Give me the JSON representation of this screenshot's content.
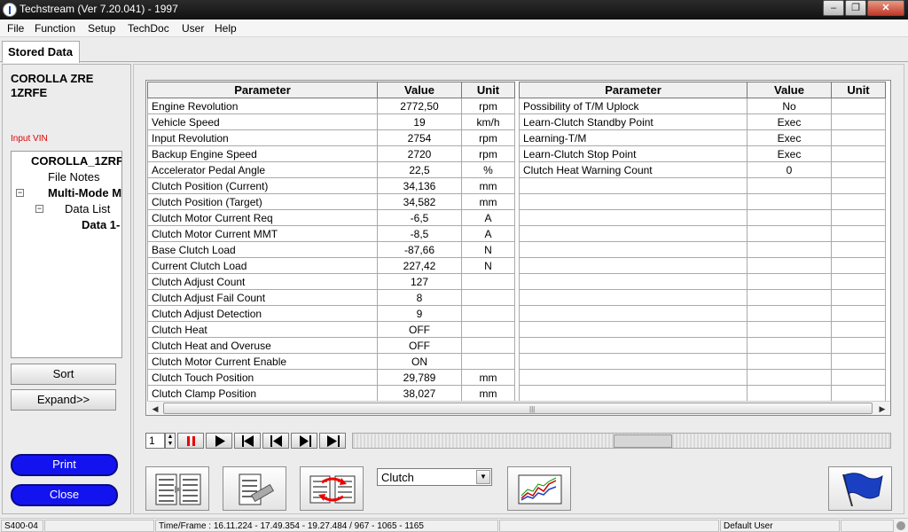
{
  "window": {
    "title": "Techstream (Ver 7.20.041) - 1997"
  },
  "menu": [
    "File",
    "Function",
    "Setup",
    "TechDoc",
    "User",
    "Help"
  ],
  "tab": {
    "label": "Stored Data"
  },
  "left": {
    "vehicle_line1": "COROLLA ZRE",
    "vehicle_line2": "1ZRFE",
    "vin_label": "Input VIN",
    "tree": {
      "root": "COROLLA_1ZRF",
      "file_notes": "File Notes",
      "multimode": "Multi-Mode M",
      "data_list": "Data List",
      "data_item": "Data 1-"
    },
    "sort_label": "Sort",
    "expand_label": "Expand>>",
    "print_label": "Print",
    "close_label": "Close"
  },
  "table": {
    "headers": {
      "parameter": "Parameter",
      "value": "Value",
      "unit": "Unit"
    },
    "left_rows": [
      {
        "param": "Engine Revolution",
        "value": "2772,50",
        "unit": "rpm"
      },
      {
        "param": "Vehicle Speed",
        "value": "19",
        "unit": "km/h"
      },
      {
        "param": "Input Revolution",
        "value": "2754",
        "unit": "rpm"
      },
      {
        "param": "Backup Engine Speed",
        "value": "2720",
        "unit": "rpm"
      },
      {
        "param": "Accelerator Pedal Angle",
        "value": "22,5",
        "unit": "%"
      },
      {
        "param": "Clutch Position (Current)",
        "value": "34,136",
        "unit": "mm"
      },
      {
        "param": "Clutch Position (Target)",
        "value": "34,582",
        "unit": "mm"
      },
      {
        "param": "Clutch Motor Current Req",
        "value": "-6,5",
        "unit": "A"
      },
      {
        "param": "Clutch Motor Current MMT",
        "value": "-8,5",
        "unit": "A"
      },
      {
        "param": "Base Clutch Load",
        "value": "-87,66",
        "unit": "N"
      },
      {
        "param": "Current Clutch Load",
        "value": "227,42",
        "unit": "N"
      },
      {
        "param": "Clutch Adjust Count",
        "value": "127",
        "unit": ""
      },
      {
        "param": "Clutch Adjust Fail Count",
        "value": "8",
        "unit": ""
      },
      {
        "param": "Clutch Adjust Detection",
        "value": "9",
        "unit": ""
      },
      {
        "param": "Clutch Heat",
        "value": "OFF",
        "unit": ""
      },
      {
        "param": "Clutch Heat and Overuse",
        "value": "OFF",
        "unit": ""
      },
      {
        "param": "Clutch Motor Current Enable",
        "value": "ON",
        "unit": ""
      },
      {
        "param": "Clutch Touch Position",
        "value": "29,789",
        "unit": "mm"
      },
      {
        "param": "Clutch Clamp Position",
        "value": "38,027",
        "unit": "mm"
      }
    ],
    "right_rows": [
      {
        "param": "Possibility of T/M Uplock",
        "value": "No",
        "unit": ""
      },
      {
        "param": "Learn-Clutch Standby Point",
        "value": "Exec",
        "unit": ""
      },
      {
        "param": "Learning-T/M",
        "value": "Exec",
        "unit": ""
      },
      {
        "param": "Learn-Clutch Stop Point",
        "value": "Exec",
        "unit": ""
      },
      {
        "param": "Clutch Heat Warning Count",
        "value": "0",
        "unit": ""
      },
      {
        "param": "",
        "value": "",
        "unit": ""
      },
      {
        "param": "",
        "value": "",
        "unit": ""
      },
      {
        "param": "",
        "value": "",
        "unit": ""
      },
      {
        "param": "",
        "value": "",
        "unit": ""
      },
      {
        "param": "",
        "value": "",
        "unit": ""
      },
      {
        "param": "",
        "value": "",
        "unit": ""
      },
      {
        "param": "",
        "value": "",
        "unit": ""
      },
      {
        "param": "",
        "value": "",
        "unit": ""
      },
      {
        "param": "",
        "value": "",
        "unit": ""
      },
      {
        "param": "",
        "value": "",
        "unit": ""
      },
      {
        "param": "",
        "value": "",
        "unit": ""
      },
      {
        "param": "",
        "value": "",
        "unit": ""
      },
      {
        "param": "",
        "value": "",
        "unit": ""
      },
      {
        "param": "",
        "value": "",
        "unit": ""
      }
    ]
  },
  "playback": {
    "frame": "1"
  },
  "filter": {
    "selected": "Clutch"
  },
  "status": {
    "code": "S400-04",
    "time_frame": "Time/Frame : 16.11.224 - 17.49.354 - 19.27.484 / 967 - 1065 - 1165",
    "user": "Default User"
  },
  "colors": {
    "accent_button": "#1313f0",
    "vin_label": "#dd0000",
    "titlebar": "#1a1a1a"
  }
}
